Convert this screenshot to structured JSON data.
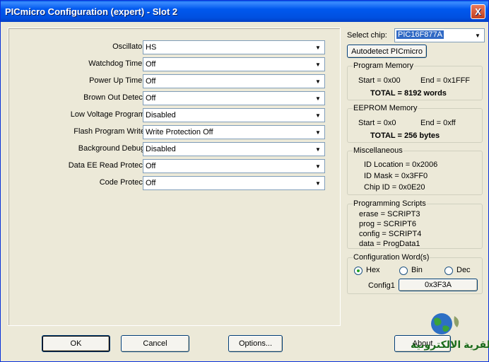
{
  "window": {
    "title": "PICmicro Configuration (expert) - Slot 2",
    "close_label": "X"
  },
  "config": [
    {
      "label": "Oscillator:",
      "value": "HS"
    },
    {
      "label": "Watchdog Timer:",
      "value": "Off"
    },
    {
      "label": "Power Up Timer:",
      "value": "Off"
    },
    {
      "label": "Brown Out Detect:",
      "value": "Off"
    },
    {
      "label": "Low Voltage Program:",
      "value": "Disabled"
    },
    {
      "label": "Flash Program Write:",
      "value": "Write Protection Off"
    },
    {
      "label": "Background Debug:",
      "value": "Disabled"
    },
    {
      "label": "Data EE Read Protect:",
      "value": "Off"
    },
    {
      "label": "Code Protect:",
      "value": "Off"
    }
  ],
  "chip": {
    "label": "Select chip:",
    "value": "PIC16F877A",
    "autodetect_label": "Autodetect PICmicro"
  },
  "program_memory": {
    "title": "Program Memory",
    "start": "Start = 0x00",
    "end": "End = 0x1FFF",
    "total": "TOTAL = 8192 words"
  },
  "eeprom_memory": {
    "title": "EEPROM Memory",
    "start": "Start = 0x0",
    "end": "End = 0xff",
    "total": "TOTAL = 256 bytes"
  },
  "misc": {
    "title": "Miscellaneous",
    "id_location": "ID Location = 0x2006",
    "id_mask": "ID Mask = 0x3FF0",
    "chip_id": "Chip ID = 0x0E20"
  },
  "scripts": {
    "title": "Programming Scripts",
    "erase": "erase = SCRIPT3",
    "prog": "prog = SCRIPT6",
    "config": "config = SCRIPT4",
    "data": "data = ProgData1"
  },
  "config_word": {
    "title": "Configuration Word(s)",
    "hex": "Hex",
    "bin": "Bin",
    "dec": "Dec",
    "selected": "Hex",
    "config1_label": "Config1",
    "config1_value": "0x3F3A"
  },
  "buttons": {
    "ok": "OK",
    "cancel": "Cancel",
    "options": "Options...",
    "about": "About"
  },
  "watermark": {
    "text": "القرية الالكترونية"
  }
}
